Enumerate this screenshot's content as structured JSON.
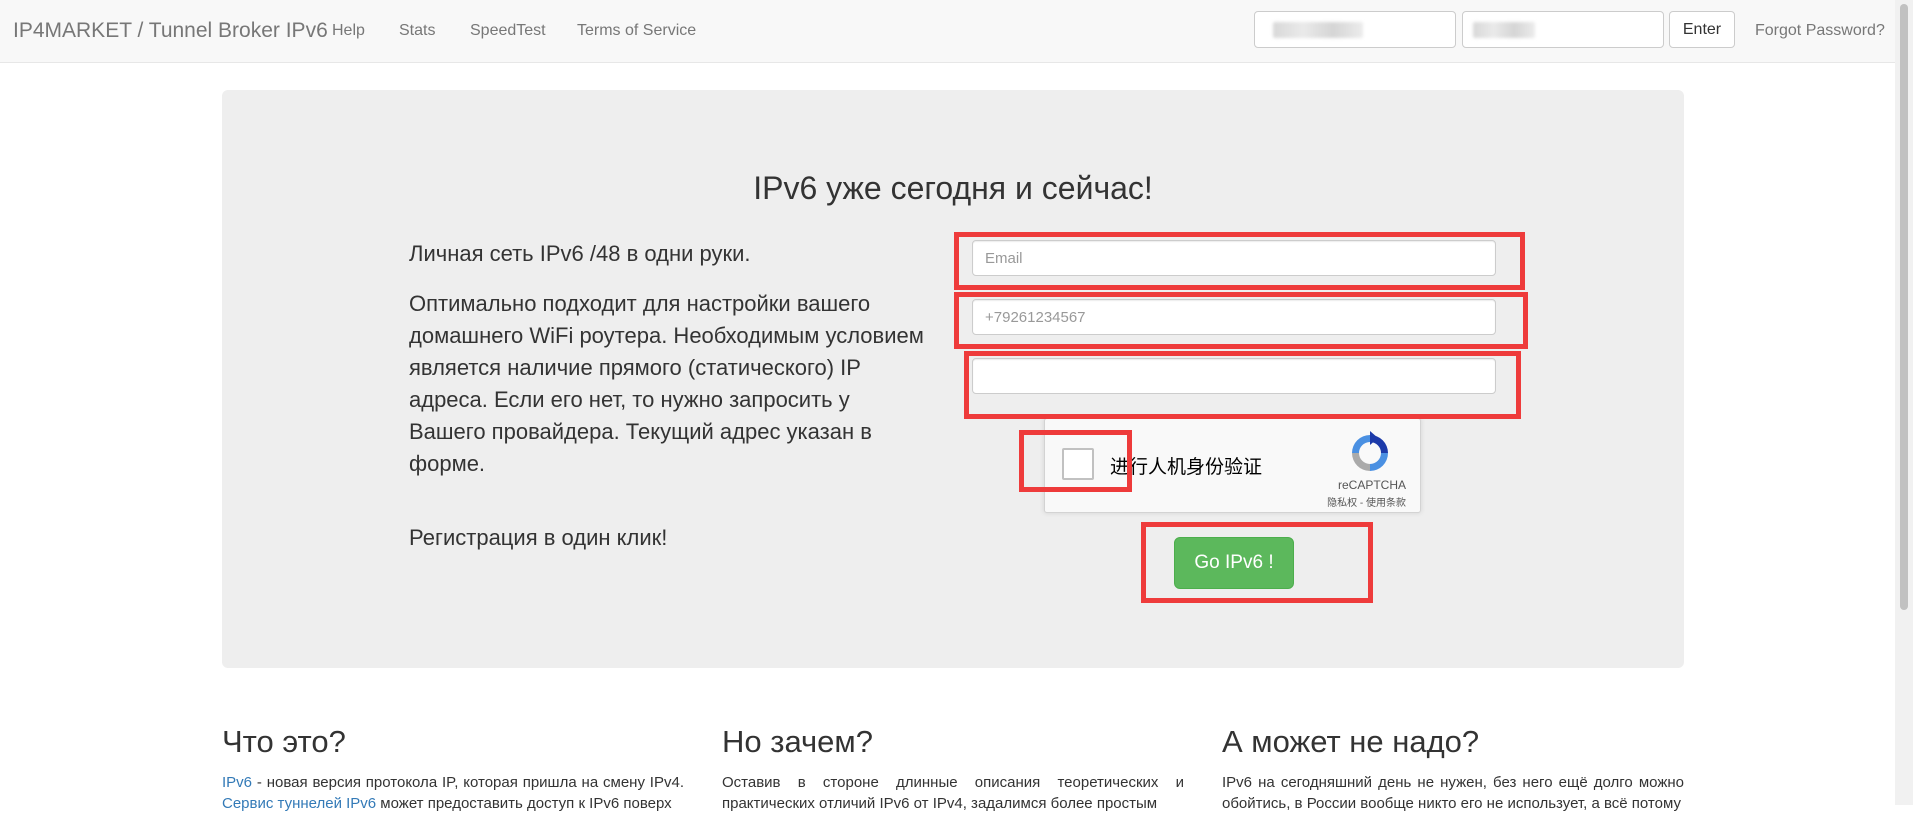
{
  "navbar": {
    "brand": "IP4MARKET / Tunnel Broker IPv6",
    "links": [
      "Help",
      "Stats",
      "SpeedTest",
      "Terms of Service"
    ],
    "enter_label": "Enter",
    "forgot_label": "Forgot Password?"
  },
  "hero": {
    "title": "IPv6 уже сегодня и сейчас!",
    "line1": "Личная сеть IPv6 /48 в одни руки.",
    "paragraph": "Оптимально подходит для настройки вашего домашнего WiFi роутера. Необходимым условием является наличие прямого (статического) IP адреса. Если его нет, то нужно запросить у Вашего провайдера. Текущий адрес указан в форме.",
    "line3": "Регистрация в один клик!"
  },
  "form": {
    "email_placeholder": "Email",
    "phone_placeholder": "+79261234567",
    "ip_value": "",
    "submit_label": "Go IPv6 !"
  },
  "recaptcha": {
    "label": "进行人机身份验证",
    "brand": "reCAPTCHA",
    "links": "隐私权 - 使用条款"
  },
  "columns": [
    {
      "title": "Что это?",
      "link1": "IPv6",
      "text1": " - новая версия протокола IP, которая пришла на смену IPv4.",
      "link2": "Сервис туннелей IPv6",
      "text2": " может предоставить доступ к IPv6 поверх"
    },
    {
      "title": "Но зачем?",
      "text": "Оставив в стороне длинные описания теоретических и практических отличий IPv6 от IPv4, задалимся более простым"
    },
    {
      "title": "А может не надо?",
      "text": "IPv6 на сегодняшний день не нужен, без него ещё долго можно обойтись, в России вообще никто его не использует, а всё потому"
    }
  ],
  "colors": {
    "accent_green": "#5cb85c",
    "highlight_red": "#ee3b3b",
    "link_blue": "#337ab7"
  }
}
